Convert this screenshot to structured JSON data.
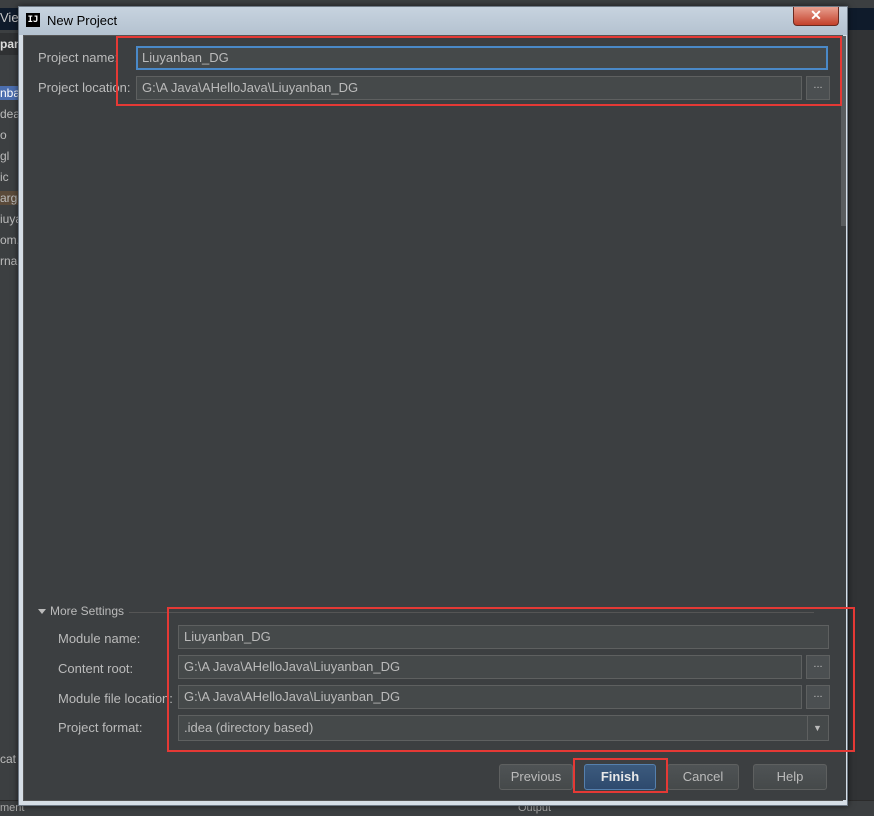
{
  "background": {
    "menu_fragment": "Vie",
    "title_fragment": "pan",
    "tree_fragments": [
      "nba",
      "dea",
      "o",
      "gl",
      "ic",
      "arge",
      "iuya",
      "om.",
      "rnal"
    ],
    "bottom_left": "cat",
    "bottom_status_left": "ment",
    "bottom_status_right": "Output"
  },
  "dialog": {
    "title": "New Project",
    "close_label": "✕",
    "project_name_label": "Project name:",
    "project_name_value": "Liuyanban_DG",
    "project_location_label": "Project location:",
    "project_location_value": "G:\\A Java\\AHelloJava\\Liuyanban_DG",
    "browse_label": "...",
    "more_settings_label": "More Settings",
    "module_name_label": "Module name:",
    "module_name_value": "Liuyanban_DG",
    "content_root_label": "Content root:",
    "content_root_value": "G:\\A Java\\AHelloJava\\Liuyanban_DG",
    "module_file_location_label": "Module file location:",
    "module_file_location_value": "G:\\A Java\\AHelloJava\\Liuyanban_DG",
    "project_format_label": "Project format:",
    "project_format_value": ".idea (directory based)",
    "buttons": {
      "previous": "Previous",
      "finish": "Finish",
      "cancel": "Cancel",
      "help": "Help"
    }
  },
  "colors": {
    "dialog_bg": "#3c3f41",
    "field_bg": "#45494a",
    "focus_border": "#4a89c8",
    "highlight": "#e53935",
    "default_button": "#2e4a6e"
  }
}
